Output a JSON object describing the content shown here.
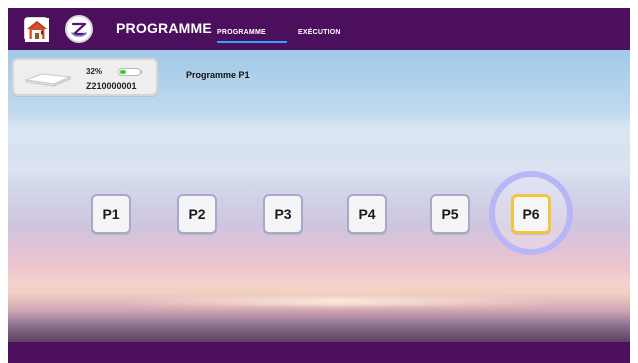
{
  "header": {
    "title": "PROGRAMME",
    "tabs": [
      {
        "label": "PROGRAMME",
        "active": true
      },
      {
        "label": "EXÉCUTION",
        "active": false
      }
    ],
    "home_icon": "home-icon",
    "logo": "brand-logo"
  },
  "device_card": {
    "battery_percent": "32%",
    "battery_level": 0.32,
    "device_id": "Z210000001",
    "device_icon": "mattress-icon"
  },
  "program_text": "Programme P1",
  "programs": [
    {
      "label": "P1"
    },
    {
      "label": "P2"
    },
    {
      "label": "P3"
    },
    {
      "label": "P4"
    },
    {
      "label": "P5"
    },
    {
      "label": "P6",
      "highlighted": true
    }
  ],
  "colors": {
    "header_bg": "#4b0f5e",
    "tab_underline": "#2ea4ff",
    "p6_border": "#f2c43f",
    "p6_ring": "#b8b6f6"
  }
}
